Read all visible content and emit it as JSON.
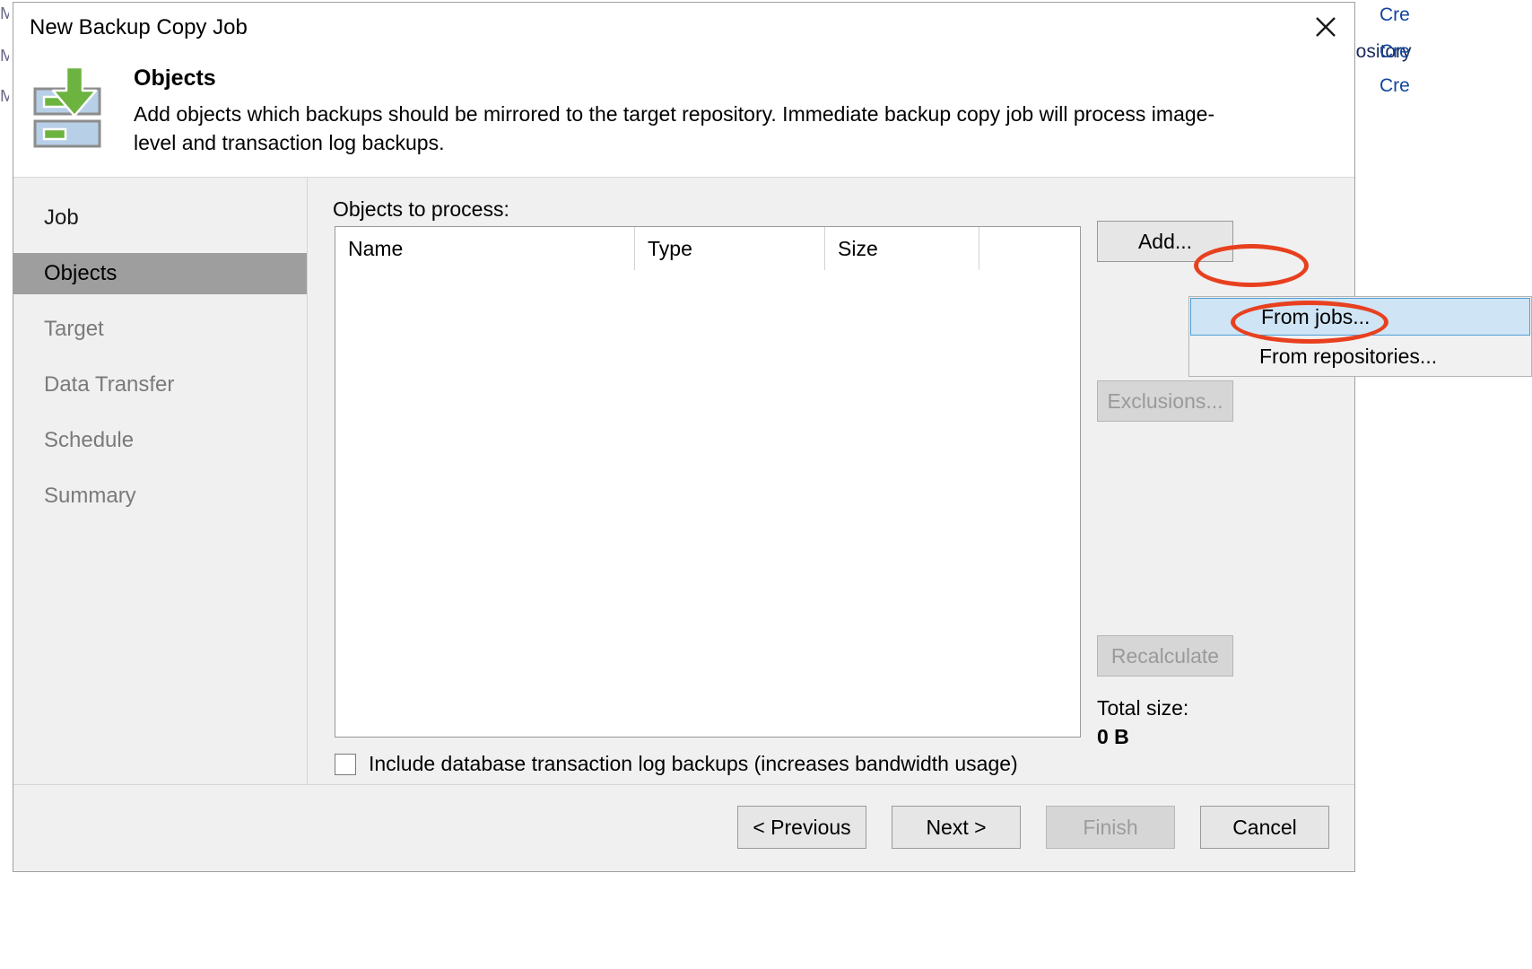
{
  "window": {
    "title": "New Backup Copy Job",
    "close_icon": "close-icon"
  },
  "header": {
    "icon": "backup-copy-objects-icon",
    "title": "Objects",
    "description": "Add objects which backups should be mirrored to the target repository. Immediate backup copy job will process image-level and transaction log backups."
  },
  "sidebar": {
    "items": [
      {
        "label": "Job",
        "state": "done"
      },
      {
        "label": "Objects",
        "state": "active"
      },
      {
        "label": "Target",
        "state": "pending"
      },
      {
        "label": "Data Transfer",
        "state": "pending"
      },
      {
        "label": "Schedule",
        "state": "pending"
      },
      {
        "label": "Summary",
        "state": "pending"
      }
    ]
  },
  "main": {
    "objects_label": "Objects to process:",
    "table": {
      "columns": [
        "Name",
        "Type",
        "Size"
      ],
      "rows": []
    },
    "include_logs_checkbox": {
      "label": "Include database transaction log backups (increases bandwidth usage)",
      "checked": false
    },
    "actions": {
      "add": "Add...",
      "exclusions": "Exclusions...",
      "recalculate": "Recalculate"
    },
    "total_size_label": "Total size:",
    "total_size_value": "0 B"
  },
  "dropdown": {
    "items": [
      {
        "label": "From jobs...",
        "highlighted": true
      },
      {
        "label": "From repositories...",
        "highlighted": false
      }
    ]
  },
  "footer": {
    "previous": "< Previous",
    "next": "Next >",
    "finish": "Finish",
    "cancel": "Cancel"
  },
  "background": {
    "repository_fragment": "pository",
    "create_1": "Cre",
    "create_2": "Cre",
    "create_3": "Cre",
    "chevron": "‹"
  },
  "colors": {
    "annotation": "#e8401f",
    "menu_highlight": "#cfe4f5",
    "sidebar_active": "#9e9e9e",
    "icon_green": "#6cb33f",
    "icon_blue": "#b8cfe8"
  }
}
